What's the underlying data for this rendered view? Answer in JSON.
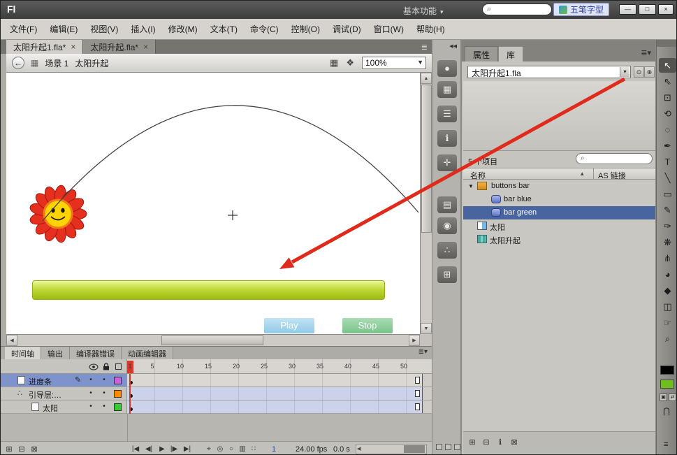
{
  "titlebar": {
    "logo": "Fl",
    "workspace_menu": "基本功能",
    "caret_glyph": "▾",
    "search_glyph": "⌕",
    "ime_label": "五笔字型",
    "minimize_glyph": "—",
    "maximize_glyph": "□",
    "close_glyph": "×"
  },
  "menubar": {
    "items": [
      "文件(F)",
      "编辑(E)",
      "视图(V)",
      "插入(I)",
      "修改(M)",
      "文本(T)",
      "命令(C)",
      "控制(O)",
      "调试(D)",
      "窗口(W)",
      "帮助(H)"
    ]
  },
  "doc_tabs": {
    "close_glyph": "×",
    "menu_glyph": "≣",
    "tabs": [
      {
        "label": "太阳升起1.fla*"
      },
      {
        "label": "太阳升起.fla*"
      }
    ]
  },
  "edit_bar": {
    "back_glyph": "←",
    "scene_icon_glyph": "▦",
    "scene_label": "场景 1",
    "symbol_label": "太阳升起",
    "edit_scene_glyph": "▦",
    "edit_symbol_glyph": "❖",
    "zoom_value": "100%",
    "caret_glyph": "▼"
  },
  "stage": {
    "play_label": "Play",
    "stop_label": "Stop",
    "progress_bar_colors": [
      "#eef695",
      "#9cbb10"
    ],
    "annotation_arrow_color": "#e02a1c"
  },
  "scrollbars": {
    "up": "▲",
    "down": "▼",
    "left": "◀",
    "right": "▶"
  },
  "dock": {
    "collapse_glyph": "◀◀",
    "icons": [
      {
        "name": "color-sphere",
        "glyph": "●"
      },
      {
        "name": "grid",
        "glyph": "▦"
      },
      {
        "name": "align-lines",
        "glyph": "☰"
      },
      {
        "name": "info",
        "glyph": "ℹ"
      },
      {
        "name": "transform-cross",
        "glyph": "✛"
      },
      {
        "name": "book",
        "glyph": "▤"
      },
      {
        "name": "orbit",
        "glyph": "◉"
      },
      {
        "name": "dots-triangle",
        "glyph": "∴"
      },
      {
        "name": "map-grid",
        "glyph": "⊞"
      }
    ]
  },
  "library": {
    "tab_properties": "属性",
    "tab_library": "库",
    "menu_glyph": "≣▾",
    "document_name": "太阳升起1.fla",
    "caret_glyph": "▾",
    "pin_glyph": "⊙",
    "new_panel_glyph": "⊕",
    "item_count": "5 个项目",
    "search_glyph": "⌕",
    "col_name": "名称",
    "sort_glyph": "▴",
    "col_linkage": "AS 链接",
    "expand_glyph": "▼",
    "items": [
      {
        "label": "buttons bar",
        "type": "folder"
      },
      {
        "label": "bar blue",
        "type": "button"
      },
      {
        "label": "bar green",
        "type": "button",
        "selected": true
      },
      {
        "label": "太阳",
        "type": "graphic"
      },
      {
        "label": "太阳升起",
        "type": "movie clip"
      }
    ],
    "footer_icons": [
      {
        "name": "new-symbol",
        "glyph": "⊞"
      },
      {
        "name": "new-folder",
        "glyph": "⊟"
      },
      {
        "name": "properties",
        "glyph": "ℹ"
      },
      {
        "name": "delete",
        "glyph": "⊠"
      }
    ]
  },
  "tools": {
    "items": [
      {
        "name": "selection",
        "glyph": "↖",
        "selected": true
      },
      {
        "name": "subselection",
        "glyph": "⇖"
      },
      {
        "name": "free-transform",
        "glyph": "⊡"
      },
      {
        "name": "3d-rotation",
        "glyph": "⟲"
      },
      {
        "name": "lasso",
        "glyph": "◌"
      },
      {
        "name": "pen",
        "glyph": "✒"
      },
      {
        "name": "text",
        "glyph": "T"
      },
      {
        "name": "line",
        "glyph": "╲"
      },
      {
        "name": "rectangle",
        "glyph": "▭"
      },
      {
        "name": "pencil",
        "glyph": "✎"
      },
      {
        "name": "brush",
        "glyph": "✑"
      },
      {
        "name": "deco",
        "glyph": "❋"
      },
      {
        "name": "bone",
        "glyph": "⋔"
      },
      {
        "name": "paint-bucket",
        "glyph": "◕"
      },
      {
        "name": "eyedropper",
        "glyph": "◆"
      },
      {
        "name": "eraser",
        "glyph": "◫"
      },
      {
        "name": "hand",
        "glyph": "☞"
      },
      {
        "name": "zoom",
        "glyph": "⌕"
      }
    ],
    "stroke_color": "#000000",
    "fill_color": "#6fbe1e",
    "bw_glyph": "▣",
    "swap_glyph": "⇄",
    "snap_glyph": "⋂",
    "options_glyph": "≡"
  },
  "timeline": {
    "tabs": [
      "时间轴",
      "输出",
      "编译器错误",
      "动画编辑器"
    ],
    "menu_glyph": "≣▾",
    "header_icons": [
      "eye",
      "lock",
      "outline"
    ],
    "ruler": [
      "1",
      "5",
      "10",
      "15",
      "20",
      "25",
      "30",
      "35",
      "40",
      "45",
      "50"
    ],
    "pencil_glyph": "✎",
    "dot_glyph": "•",
    "guide_icon_glyph": "∴",
    "layers": [
      {
        "name": "进度条",
        "outline_color": "#c964d9",
        "selected": true,
        "editing": true
      },
      {
        "name": "引导层:…",
        "outline_color": "#ff8a00"
      },
      {
        "name": "太阳",
        "outline_color": "#33cc33",
        "indented": true
      }
    ],
    "footer_icons": [
      {
        "name": "new-layer",
        "glyph": "⊞"
      },
      {
        "name": "new-folder",
        "glyph": "⊟"
      },
      {
        "name": "delete-layer",
        "glyph": "⊠"
      }
    ],
    "playback": [
      {
        "name": "go-to-first-frame",
        "glyph": "|◀"
      },
      {
        "name": "step-back",
        "glyph": "◀|"
      },
      {
        "name": "play",
        "glyph": "▶"
      },
      {
        "name": "step-forward",
        "glyph": "|▶"
      },
      {
        "name": "go-to-last-frame",
        "glyph": "▶|"
      }
    ],
    "onion": [
      {
        "name": "center-frame",
        "glyph": "⌖"
      },
      {
        "name": "onion-skin",
        "glyph": "◎"
      },
      {
        "name": "onion-skin-outlines",
        "glyph": "○"
      },
      {
        "name": "edit-multiple-frames",
        "glyph": "▥"
      },
      {
        "name": "modify-markers",
        "glyph": "∷"
      }
    ],
    "status": {
      "frame": "1",
      "fps": "24.00 fps",
      "time": "0.0 s"
    }
  }
}
